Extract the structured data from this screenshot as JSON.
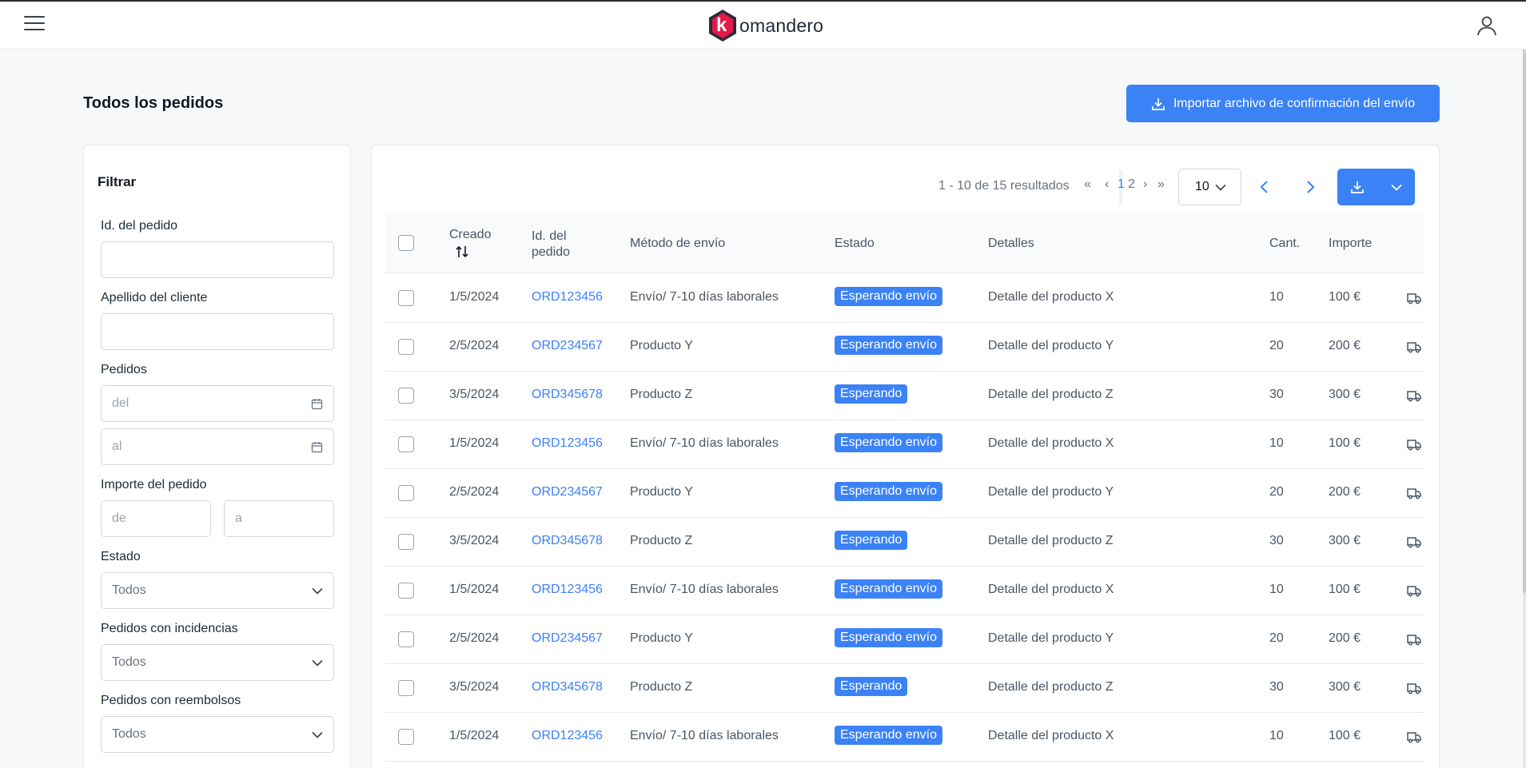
{
  "header": {
    "brand_letter": "k",
    "brand_rest": "omandero"
  },
  "page": {
    "title": "Todos los pedidos",
    "import_button": "Importar archivo de confirmación del envío"
  },
  "filter": {
    "title": "Filtrar",
    "order_id_label": "Id. del pedido",
    "last_name_label": "Apellido del cliente",
    "orders_label": "Pedidos",
    "date_from_placeholder": "del",
    "date_to_placeholder": "al",
    "amount_label": "Importe del pedido",
    "amount_from_placeholder": "de",
    "amount_to_placeholder": "a",
    "status_label": "Estado",
    "status_value": "Todos",
    "incidents_label": "Pedidos con incidencias",
    "incidents_value": "Todos",
    "refunds_label": "Pedidos con reembolsos",
    "refunds_value": "Todos"
  },
  "pagination": {
    "summary": "1 - 10 de 15 resultados",
    "first": "«",
    "prev": "‹",
    "pages": [
      "1",
      "2"
    ],
    "next": "›",
    "last": "»",
    "current_page": "1",
    "per_page": "10"
  },
  "table": {
    "headers": {
      "created": "Creado",
      "order_id_1": "Id. del",
      "order_id_2": "pedido",
      "shipping": "Método de envío",
      "status": "Estado",
      "details": "Detalles",
      "qty": "Cant.",
      "amount": "Importe"
    },
    "rows": [
      {
        "created": "1/5/2024",
        "order_id": "ORD123456",
        "shipping": "Envío/ 7-10 días laborales",
        "status": "Esperando envío",
        "details": "Detalle del producto X",
        "qty": "10",
        "amount": "100 €"
      },
      {
        "created": "2/5/2024",
        "order_id": "ORD234567",
        "shipping": "Producto Y",
        "status": "Esperando envío",
        "details": "Detalle del producto Y",
        "qty": "20",
        "amount": "200 €"
      },
      {
        "created": "3/5/2024",
        "order_id": "ORD345678",
        "shipping": "Producto Z",
        "status": "Esperando",
        "details": "Detalle del producto Z",
        "qty": "30",
        "amount": "300 €"
      },
      {
        "created": "1/5/2024",
        "order_id": "ORD123456",
        "shipping": "Envío/ 7-10 días laborales",
        "status": "Esperando envío",
        "details": "Detalle del producto X",
        "qty": "10",
        "amount": "100 €"
      },
      {
        "created": "2/5/2024",
        "order_id": "ORD234567",
        "shipping": "Producto Y",
        "status": "Esperando envío",
        "details": "Detalle del producto Y",
        "qty": "20",
        "amount": "200 €"
      },
      {
        "created": "3/5/2024",
        "order_id": "ORD345678",
        "shipping": "Producto Z",
        "status": "Esperando",
        "details": "Detalle del producto Z",
        "qty": "30",
        "amount": "300 €"
      },
      {
        "created": "1/5/2024",
        "order_id": "ORD123456",
        "shipping": "Envío/ 7-10 días laborales",
        "status": "Esperando envío",
        "details": "Detalle del producto X",
        "qty": "10",
        "amount": "100 €"
      },
      {
        "created": "2/5/2024",
        "order_id": "ORD234567",
        "shipping": "Producto Y",
        "status": "Esperando envío",
        "details": "Detalle del producto Y",
        "qty": "20",
        "amount": "200 €"
      },
      {
        "created": "3/5/2024",
        "order_id": "ORD345678",
        "shipping": "Producto Z",
        "status": "Esperando",
        "details": "Detalle del producto Z",
        "qty": "30",
        "amount": "300 €"
      },
      {
        "created": "1/5/2024",
        "order_id": "ORD123456",
        "shipping": "Envío/ 7-10 días laborales",
        "status": "Esperando envío",
        "details": "Detalle del producto X",
        "qty": "10",
        "amount": "100 €"
      }
    ]
  },
  "colors": {
    "accent": "#3b82f6",
    "brand": "#e6194b",
    "brand_dark": "#2d2d3a"
  },
  "icons": [
    "hamburger-icon",
    "user-icon",
    "download-icon",
    "calendar-icon",
    "chevron-down-icon",
    "chevron-left-icon",
    "chevron-right-icon",
    "sort-icon",
    "truck-icon"
  ]
}
